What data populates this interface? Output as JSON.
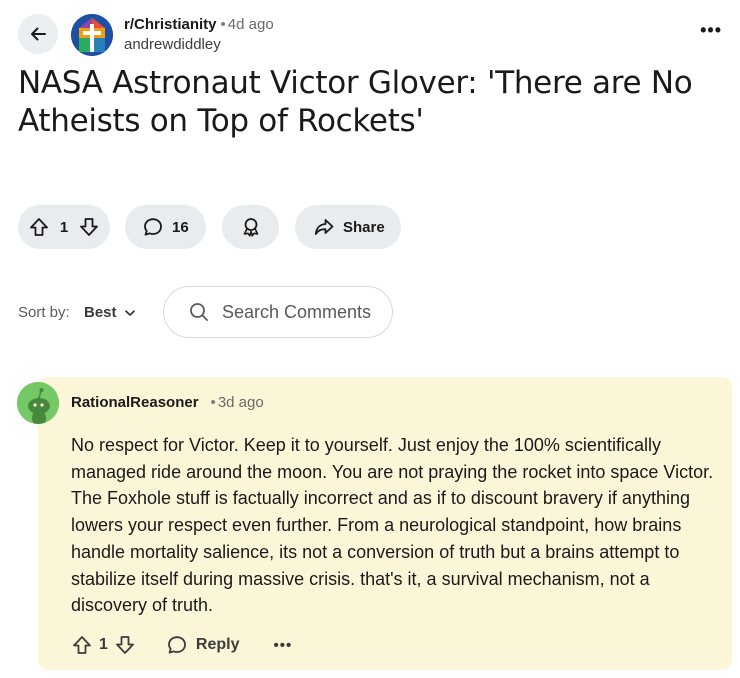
{
  "post": {
    "subreddit": "r/Christianity",
    "separator": "•",
    "time": "4d ago",
    "author": "andrewdiddley",
    "title": "NASA Astronaut Victor Glover: 'There are No Atheists on Top of Rockets'",
    "more": "•••"
  },
  "actions": {
    "votes": "1",
    "comments": "16",
    "share": "Share"
  },
  "sort": {
    "label": "Sort by:",
    "value": "Best"
  },
  "search": {
    "placeholder": "Search Comments"
  },
  "comment": {
    "author": "RationalReasoner",
    "separator": "•",
    "time": "3d ago",
    "body": "No respect for Victor. Keep it to yourself. Just enjoy the 100% scientifically managed ride around the moon. You are not praying the rocket into space Victor. The Foxhole stuff is factually incorrect and as if to discount bravery if anything lowers your respect even further. From a neurological standpoint, how brains handle mortality salience, its not a conversion of truth but a brains attempt to stabilize itself during massive crisis. that's it, a survival mechanism, not a discovery of truth.",
    "votes": "1",
    "reply": "Reply",
    "more": "•••"
  },
  "colors": {
    "pill_bg": "#e9ecee",
    "comment_highlight": "#fcf6d8",
    "text": "#1a1a1b"
  },
  "icons": [
    "back-arrow-icon",
    "subreddit-icon",
    "more-icon",
    "upvote-icon",
    "downvote-icon",
    "comment-icon",
    "award-icon",
    "share-icon",
    "chevron-down-icon",
    "search-icon",
    "avatar-icon",
    "reply-icon"
  ]
}
